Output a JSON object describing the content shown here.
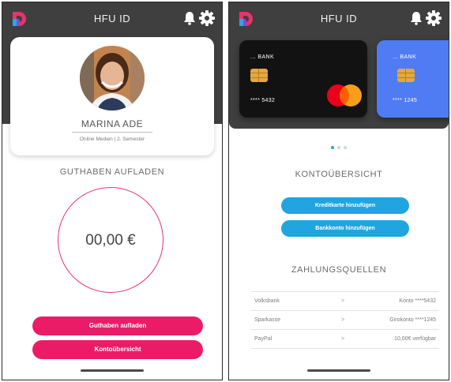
{
  "app": {
    "title": "HFU ID"
  },
  "colors": {
    "topbar": "#3f3f3f",
    "pink_accent": "#ec1b68",
    "blue_accent": "#20a5e0",
    "card_blue": "#4f7cf3"
  },
  "icons": [
    "app-logo-icon",
    "bell-icon",
    "gear-icon",
    "chip-icon",
    "mastercard-icon"
  ],
  "profile_screen": {
    "name": "MARINA ADE",
    "meta": "Online Medien | 2. Semester",
    "topup_heading": "GUTHABEN AUFLADEN",
    "balance": "00,00 €",
    "buttons": {
      "topup": "Guthaben aufladen",
      "overview": "Kontoübersicht"
    }
  },
  "account_screen": {
    "cards": [
      {
        "bank": "... BANK",
        "number": "**** 5432"
      },
      {
        "bank": "... BANK",
        "number": "**** 1245"
      }
    ],
    "carousel": {
      "count": 3,
      "active_index": 0
    },
    "overview_heading": "KONTOÜBERSICHT",
    "buttons": {
      "add_card": "Kreditkarte hinzufügen",
      "add_bank": "Bankkonto hinzufügen"
    },
    "sources_heading": "ZAHLUNGSQUELLEN",
    "sources": [
      {
        "name": "Volksbank",
        "separator": ">",
        "detail": "Konto ****5432"
      },
      {
        "name": "Sparkasse",
        "separator": ">",
        "detail": "Girokonto ****1245"
      },
      {
        "name": "PayPal",
        "separator": ">",
        "detail": "10,00€ verfügbar"
      }
    ]
  }
}
